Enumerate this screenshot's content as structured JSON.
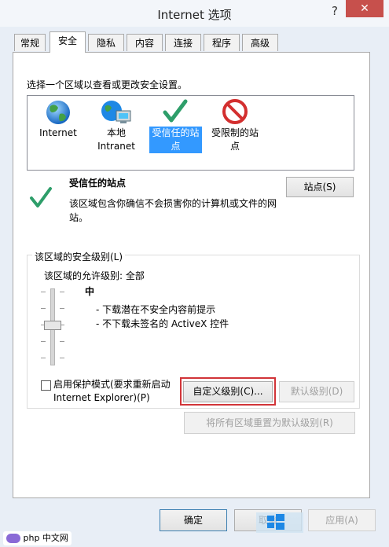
{
  "window": {
    "title": "Internet 选项",
    "help": "?",
    "close": "✕"
  },
  "tabs": [
    {
      "label": "常规"
    },
    {
      "label": "安全"
    },
    {
      "label": "隐私"
    },
    {
      "label": "内容"
    },
    {
      "label": "连接"
    },
    {
      "label": "程序"
    },
    {
      "label": "高级"
    }
  ],
  "zones": {
    "instruction": "选择一个区域以查看或更改安全设置。",
    "items": [
      {
        "label": "Internet",
        "icon": "globe-icon"
      },
      {
        "label": "本地 Intranet",
        "icon": "intranet-icon"
      },
      {
        "label": "受信任的站点",
        "icon": "checkmark-icon",
        "selected": true
      },
      {
        "label": "受限制的站点",
        "icon": "restricted-icon"
      }
    ]
  },
  "zone_info": {
    "name": "受信任的站点",
    "description": "该区域包含你确信不会损害你的计算机或文件的网站。",
    "sites_button": "站点(S)"
  },
  "security_level": {
    "legend": "该区域的安全级别(L)",
    "allowed": "该区域的允许级别: 全部",
    "level_name": "中",
    "bullets": [
      "- 下载潜在不安全内容前提示",
      "- 不下载未签名的 ActiveX 控件"
    ],
    "protected_mode": "启用保护模式(要求重新启动 Internet Explorer)(P)",
    "custom_button": "自定义级别(C)...",
    "default_button": "默认级别(D)",
    "reset_all_button": "将所有区域重置为默认级别(R)"
  },
  "footer": {
    "ok": "确定",
    "cancel": "取消",
    "apply": "应用(A)"
  },
  "watermark": {
    "text": "php 中文网"
  },
  "colors": {
    "selection": "#3399ff",
    "highlight_border": "#d13438",
    "close": "#c7504c"
  }
}
